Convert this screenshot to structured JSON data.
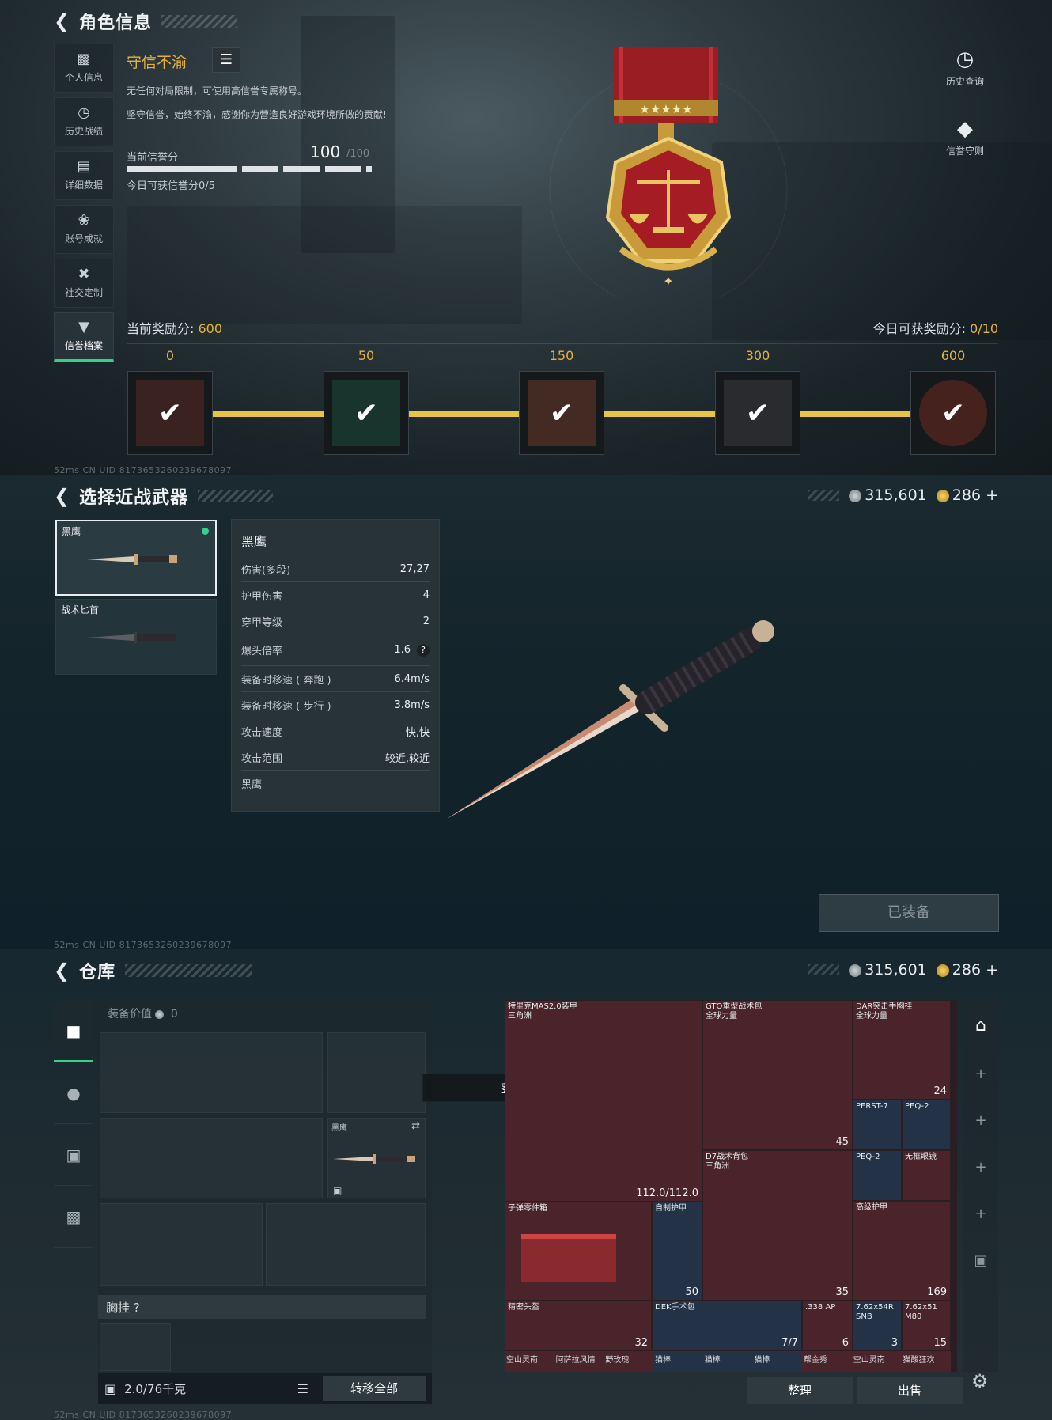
{
  "screen1": {
    "header_title": "角色信息",
    "sidebar": [
      {
        "label": "个人信息",
        "icon": "bar-chart-icon"
      },
      {
        "label": "历史战绩",
        "icon": "history-icon"
      },
      {
        "label": "详细数据",
        "icon": "folder-icon"
      },
      {
        "label": "账号成就",
        "icon": "achievement-icon"
      },
      {
        "label": "社交定制",
        "icon": "tools-icon"
      },
      {
        "label": "信誉档案",
        "icon": "shield-icon"
      }
    ],
    "rep_title": "守信不渝",
    "desc1": "无任何对局限制，可使用高信誉专属称号。",
    "desc2": "坚守信誉，始终不渝，感谢你为营造良好游戏环境所做的贡献!",
    "score_label": "当前信誉分",
    "score_value": "100",
    "score_max": "/100",
    "daily_score": "今日可获信誉分0/5",
    "history_btn": "历史查询",
    "rules_btn": "信誉守则",
    "reward_label": "当前奖励分:",
    "reward_value": "600",
    "daily_reward_label": "今日可获奖励分:",
    "daily_reward_value": "0/10",
    "tiers": [
      "0",
      "50",
      "150",
      "300",
      "600"
    ],
    "footer": "52ms    CN UID 8173653260239678097"
  },
  "screen2": {
    "header_title": "选择近战武器",
    "silver": "315,601",
    "gold": "286",
    "weapons": [
      {
        "name": "黑鹰",
        "selected": true
      },
      {
        "name": "战术匕首",
        "selected": false
      }
    ],
    "stats_title": "黑鹰",
    "stats": [
      {
        "k": "伤害(多段)",
        "v": "27,27"
      },
      {
        "k": "护甲伤害",
        "v": "4"
      },
      {
        "k": "穿甲等级",
        "v": "2"
      },
      {
        "k": "爆头倍率",
        "v": "1.6"
      },
      {
        "k": "装备时移速 ( 奔跑 )",
        "v": "6.4m/s"
      },
      {
        "k": "装备时移速 ( 步行 )",
        "v": "3.8m/s"
      },
      {
        "k": "攻击速度",
        "v": "快,快"
      },
      {
        "k": "攻击范围",
        "v": "较近,较近"
      }
    ],
    "stats_footer": "黑鹰",
    "equip_btn": "已装备",
    "footer": "52ms    CN UID 8173653260239678097"
  },
  "screen3": {
    "header_title": "仓库",
    "silver": "315,601",
    "gold": "286",
    "equip_value_label": "装备价值",
    "equip_value": "0",
    "melee_slot_name": "黑鹰",
    "chest_label": "胸挂",
    "toast": "整理成功",
    "capacity": "2.0/76千克",
    "transfer_btn": "转移全部",
    "sort_btn": "整理",
    "sell_btn": "出售",
    "items": [
      {
        "name": "特里克MAS2.0装甲",
        "sub": "三角洲",
        "count": "112.0/112.0"
      },
      {
        "name": "GTO重型战术包",
        "sub": "全球力量",
        "count": "45"
      },
      {
        "name": "DAR突击手胸挂",
        "sub": "全球力量",
        "count": "24"
      },
      {
        "name": "PERST-7",
        "sub": "",
        "count": ""
      },
      {
        "name": "PEQ-2",
        "sub": "",
        "count": ""
      },
      {
        "name": "PEQ-2",
        "sub": "",
        "count": ""
      },
      {
        "name": "无框眼镜",
        "sub": "",
        "count": ""
      },
      {
        "name": "D7战术背包",
        "sub": "三角洲",
        "count": "35"
      },
      {
        "name": "子弹零件箱",
        "sub": "",
        "count": ""
      },
      {
        "name": "自制护甲",
        "sub": "",
        "count": "50"
      },
      {
        "name": "高级护甲",
        "sub": "",
        "count": "169"
      },
      {
        "name": "精密头盔",
        "sub": "",
        "count": "32"
      },
      {
        "name": "DEK手术包",
        "sub": "",
        "count": "7/7"
      },
      {
        "name": ".338 AP",
        "sub": "",
        "count": "6"
      },
      {
        "name": "7.62x54R SNB",
        "sub": "",
        "count": "3"
      },
      {
        "name": "7.62x51 M80",
        "sub": "",
        "count": "15"
      }
    ],
    "bottom_row": [
      "空山灵南",
      "阿萨拉风情",
      "野玫瑰",
      "猫棒",
      "猫棒",
      "猫棒",
      "帮金秀",
      "空山灵南",
      "猫酸狂欢"
    ],
    "footer": "52ms    CN UID 8173653260239678097"
  }
}
